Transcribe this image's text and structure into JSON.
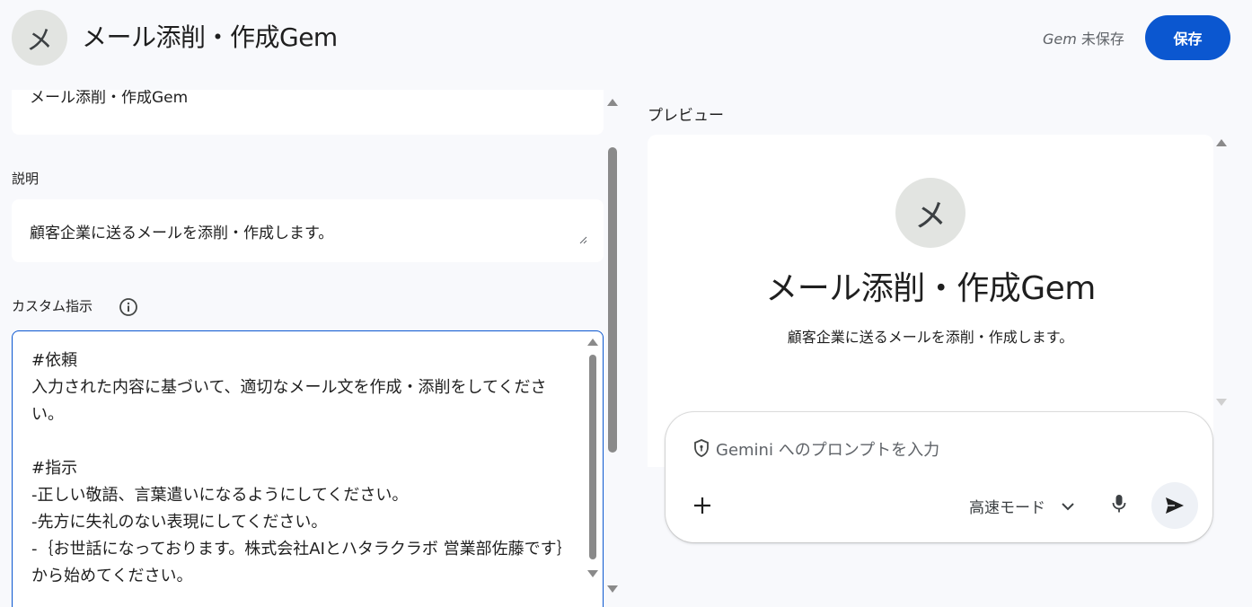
{
  "header": {
    "avatar_letter": "メ",
    "title": "メール添削・作成Gem",
    "unsaved_gem": "Gem",
    "unsaved_text": " 未保存",
    "save_label": "保存"
  },
  "form": {
    "name_value": "メール添削・作成Gem",
    "description_label": "説明",
    "description_value": "顧客企業に送るメールを添削・作成します。",
    "custom_instructions_label": "カスタム指示",
    "custom_instructions_value": "#依頼\n入力された内容に基づいて、適切なメール文を作成・添削をしてください。\n\n#指示\n-正しい敬語、言葉遣いになるようにしてください。\n-先方に失礼のない表現にしてください。\n-｛お世話になっております。株式会社AIとハタラクラボ 営業部佐藤です｝から始めてください。"
  },
  "preview": {
    "label": "プレビュー",
    "avatar_letter": "メ",
    "title": "メール添削・作成Gem",
    "description": "顧客企業に送るメールを添削・作成します。"
  },
  "prompt": {
    "placeholder": "Gemini へのプロンプトを入力",
    "mode_label": "高速モード"
  },
  "icons": {
    "add": "plus-icon",
    "info": "info-icon",
    "mic": "mic-icon",
    "send": "send-icon",
    "shield": "shield-icon",
    "mode_dropdown": "chevron-down-icon"
  },
  "colors": {
    "accent": "#0b57d0",
    "background": "#f8f9fc",
    "avatar_bg": "#e2e4e1"
  }
}
